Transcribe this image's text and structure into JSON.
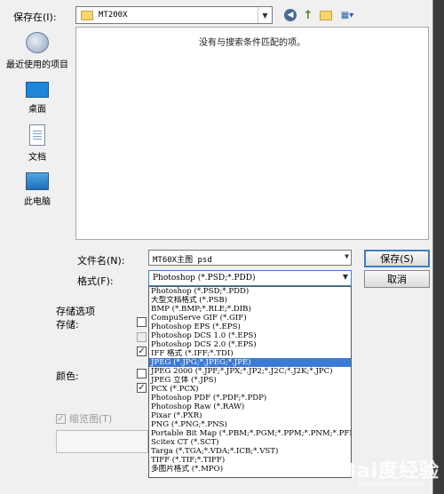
{
  "save_in": {
    "label": "保存在(I):",
    "folder": "MT200X"
  },
  "toolbar": {
    "back": "◀",
    "up": "↑",
    "view": "▦▾"
  },
  "places": [
    {
      "label": "最近使用的项目",
      "icon": "recent-items-icon"
    },
    {
      "label": "桌面",
      "icon": "desktop-icon"
    },
    {
      "label": "文档",
      "icon": "documents-icon"
    },
    {
      "label": "此电脑",
      "icon": "this-pc-icon"
    }
  ],
  "file_list": {
    "empty_message": "没有与搜索条件匹配的项。"
  },
  "filename": {
    "label": "文件名(N):",
    "value": "MT60X主图 psd"
  },
  "format": {
    "label": "格式(F):",
    "value": "Photoshop (*.PSD;*.PDD)"
  },
  "buttons": {
    "save": "保存(S)",
    "cancel": "取消"
  },
  "options": {
    "title": "存储选项",
    "save_label": "存储:",
    "color_label": "颜色:",
    "thumbnail": "缩览图(T)"
  },
  "format_options": [
    "Photoshop (*.PSD;*.PDD)",
    "大型文档格式 (*.PSB)",
    "BMP (*.BMP;*.RLE;*.DIB)",
    "CompuServe GIF (*.GIF)",
    "Photoshop EPS (*.EPS)",
    "Photoshop DCS 1.0 (*.EPS)",
    "Photoshop DCS 2.0 (*.EPS)",
    "IFF 格式 (*.IFF;*.TDI)",
    "JPEG (*.JPG;*.JPEG;*.JPE)",
    "JPEG 2000 (*.JPF;*.JPX;*.JP2;*.J2C;*.J2K;*.JPC)",
    "JPEG 立体 (*.JPS)",
    "PCX (*.PCX)",
    "Photoshop PDF (*.PDF;*.PDP)",
    "Photoshop Raw (*.RAW)",
    "Pixar (*.PXR)",
    "PNG (*.PNG;*.PNS)",
    "Portable Bit Map (*.PBM;*.PGM;*.PPM;*.PNM;*.PFM;*.PAM)",
    "Scitex CT (*.SCT)",
    "Targa (*.TGA;*.VDA;*.ICB;*.VST)",
    "TIFF (*.TIF;*.TIFF)",
    "多图片格式 (*.MPO)"
  ],
  "selected_format_index": 8,
  "watermark": {
    "logo": "Bai度经验",
    "url": "jingyan.baidu.com"
  }
}
